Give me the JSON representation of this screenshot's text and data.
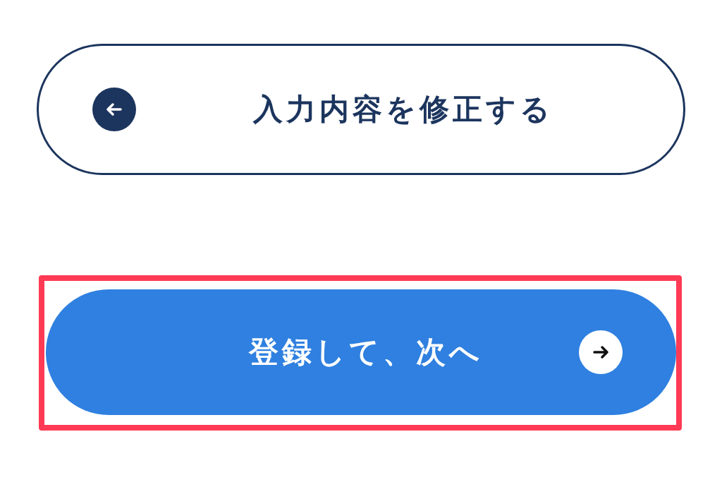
{
  "buttons": [
    {
      "kind": "back",
      "label": "入力内容を修正する",
      "highlighted": false
    },
    {
      "kind": "next",
      "label": "登録して、次へ",
      "highlighted": true
    }
  ]
}
